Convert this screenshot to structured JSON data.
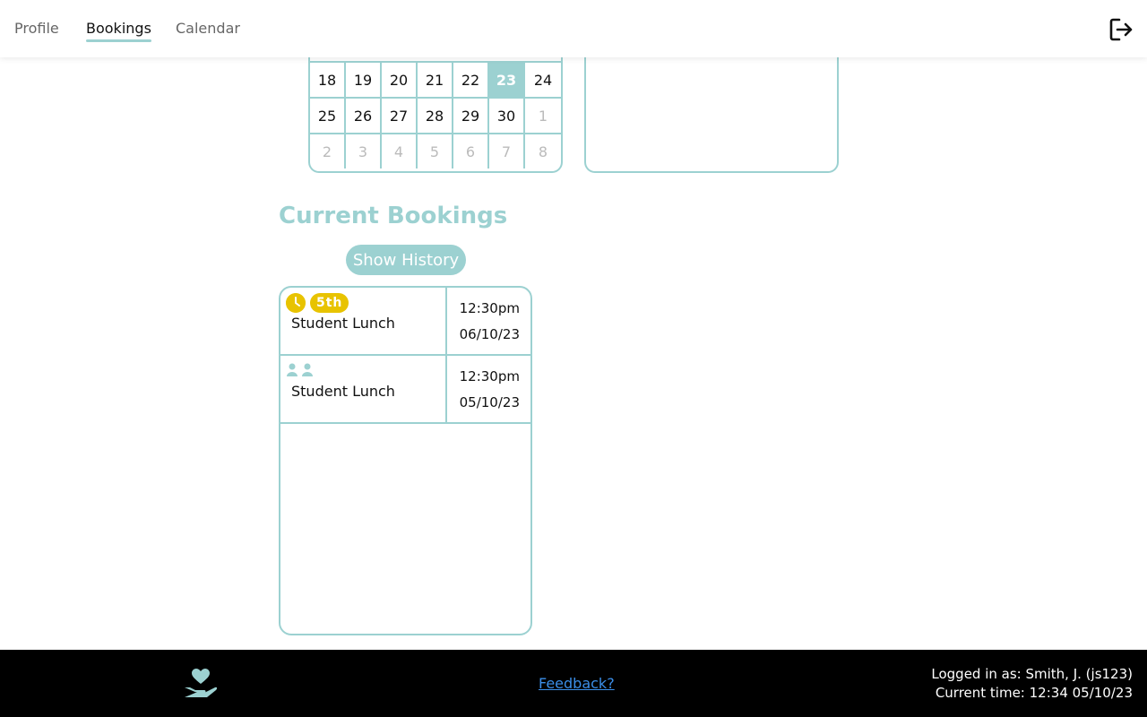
{
  "nav": {
    "tabs": [
      {
        "label": "Profile"
      },
      {
        "label": "Bookings"
      },
      {
        "label": "Calendar"
      }
    ],
    "active_tab": "Bookings",
    "logout_icon": "logout-icon"
  },
  "calendar": {
    "weeks": [
      [
        {
          "d": "18"
        },
        {
          "d": "19"
        },
        {
          "d": "20"
        },
        {
          "d": "21"
        },
        {
          "d": "22"
        },
        {
          "d": "23",
          "today": true
        },
        {
          "d": "24"
        }
      ],
      [
        {
          "d": "25"
        },
        {
          "d": "26"
        },
        {
          "d": "27"
        },
        {
          "d": "28"
        },
        {
          "d": "29"
        },
        {
          "d": "30"
        },
        {
          "d": "1",
          "muted": true
        }
      ],
      [
        {
          "d": "2",
          "muted": true
        },
        {
          "d": "3",
          "muted": true
        },
        {
          "d": "4",
          "muted": true
        },
        {
          "d": "5",
          "muted": true
        },
        {
          "d": "6",
          "muted": true
        },
        {
          "d": "7",
          "muted": true
        },
        {
          "d": "8",
          "muted": true
        }
      ]
    ]
  },
  "bookings": {
    "title": "Current Bookings",
    "history_button": "Show History",
    "items": [
      {
        "name": "Student Lunch",
        "time": "12:30pm",
        "date": "06/10/23",
        "icon": "clock-icon",
        "badge": "5th"
      },
      {
        "name": "Student Lunch",
        "time": "12:30pm",
        "date": "05/10/23",
        "icon": "people-icon",
        "badge": ""
      }
    ]
  },
  "footer": {
    "logo_icon": "heart-hand-icon",
    "feedback": "Feedback?",
    "logged_in": "Logged in as: Smith, J. (js123)",
    "current_time": "Current time: 12:34 05/10/23"
  },
  "colors": {
    "accent": "#9cd1d1",
    "badge": "#e8c300",
    "footer_bg": "#000000",
    "link": "#3b8ee8"
  }
}
